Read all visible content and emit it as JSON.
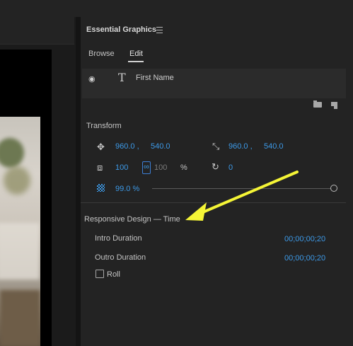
{
  "panel": {
    "title": "Essential Graphics",
    "tabs": [
      {
        "label": "Browse",
        "active": false
      },
      {
        "label": "Edit",
        "active": true
      }
    ],
    "layer": {
      "name": "First Name",
      "icon": "text-layer-icon"
    }
  },
  "transform": {
    "title": "Transform",
    "position": {
      "x": "960.0 ,",
      "y": "540.0"
    },
    "anchor": {
      "x": "960.0 ,",
      "y": "540.0"
    },
    "scale": {
      "value": "100",
      "linked_value": "100",
      "unit": "%"
    },
    "rotation": "0",
    "opacity": {
      "value": "99.0 %",
      "fraction": 0.99
    }
  },
  "responsive": {
    "title": "Responsive Design — Time",
    "intro": {
      "label": "Intro Duration",
      "value": "00;00;00;20"
    },
    "outro": {
      "label": "Outro Duration",
      "value": "00;00;00;20"
    },
    "roll": {
      "label": "Roll",
      "checked": false
    }
  },
  "colors": {
    "accent": "#3d9ae8",
    "annotation": "#f5f536"
  }
}
